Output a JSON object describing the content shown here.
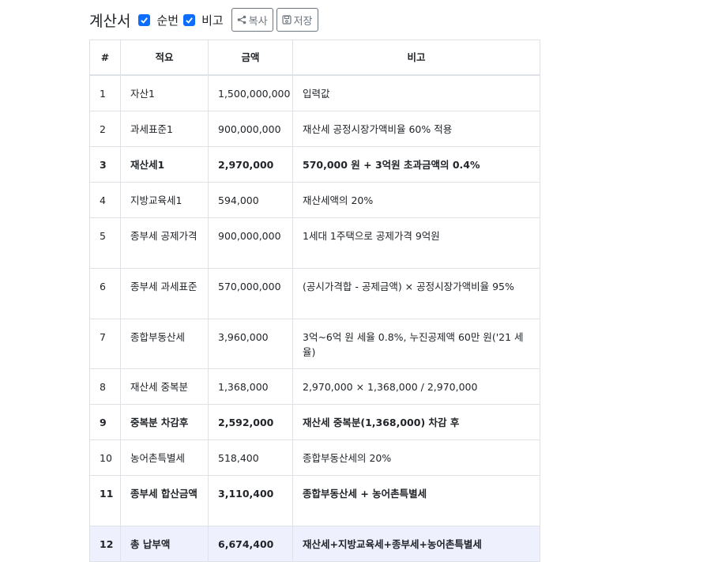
{
  "header": {
    "title": "계산서",
    "check_seq": "순번",
    "check_note": "비고",
    "copy_label": "복사",
    "save_label": "저장"
  },
  "table": {
    "columns": [
      "#",
      "적요",
      "금액",
      "비고"
    ],
    "rows": [
      {
        "no": "1",
        "item": "자산1",
        "amount": "1,500,000,000",
        "note": "입력값"
      },
      {
        "no": "2",
        "item": "과세표준1",
        "amount": "900,000,000",
        "note": "재산세 공정시장가액비율 60% 적용"
      },
      {
        "no": "3",
        "item": "재산세1",
        "amount": "2,970,000",
        "note": "570,000 원 + 3억원 초과금액의 0.4%"
      },
      {
        "no": "4",
        "item": "지방교육세1",
        "amount": "594,000",
        "note": "재산세액의 20%"
      },
      {
        "no": "5",
        "item": "종부세 공제가격",
        "amount": "900,000,000",
        "note": "1세대 1주택으로 공제가격 9억원"
      },
      {
        "no": "6",
        "item": "종부세 과세표준",
        "amount": "570,000,000",
        "note": "(공시가격합 - 공제금액) × 공정시장가액비율 95%"
      },
      {
        "no": "7",
        "item": "종합부동산세",
        "amount": "3,960,000",
        "note": "3억~6억 원 세율 0.8%, 누진공제액 60만 원('21 세율)"
      },
      {
        "no": "8",
        "item": "재산세 중복분",
        "amount": "1,368,000",
        "note": "2,970,000 × 1,368,000 / 2,970,000"
      },
      {
        "no": "9",
        "item": "중복분 차감후",
        "amount": "2,592,000",
        "note": "재산세 중복분(1,368,000) 차감 후"
      },
      {
        "no": "10",
        "item": "농어촌특별세",
        "amount": "518,400",
        "note": "종합부동산세의 20%"
      },
      {
        "no": "11",
        "item": "종부세 합산금액",
        "amount": "3,110,400",
        "note": "종합부동산세 + 농어촌특별세"
      },
      {
        "no": "12",
        "item": "총 납부액",
        "amount": "6,674,400",
        "note": "재산세+지방교육세+종부세+농어촌특별세"
      }
    ]
  },
  "colors": {
    "accent": "#0d6efd",
    "highlight": "#eef0fd",
    "border": "#dee2e6"
  }
}
